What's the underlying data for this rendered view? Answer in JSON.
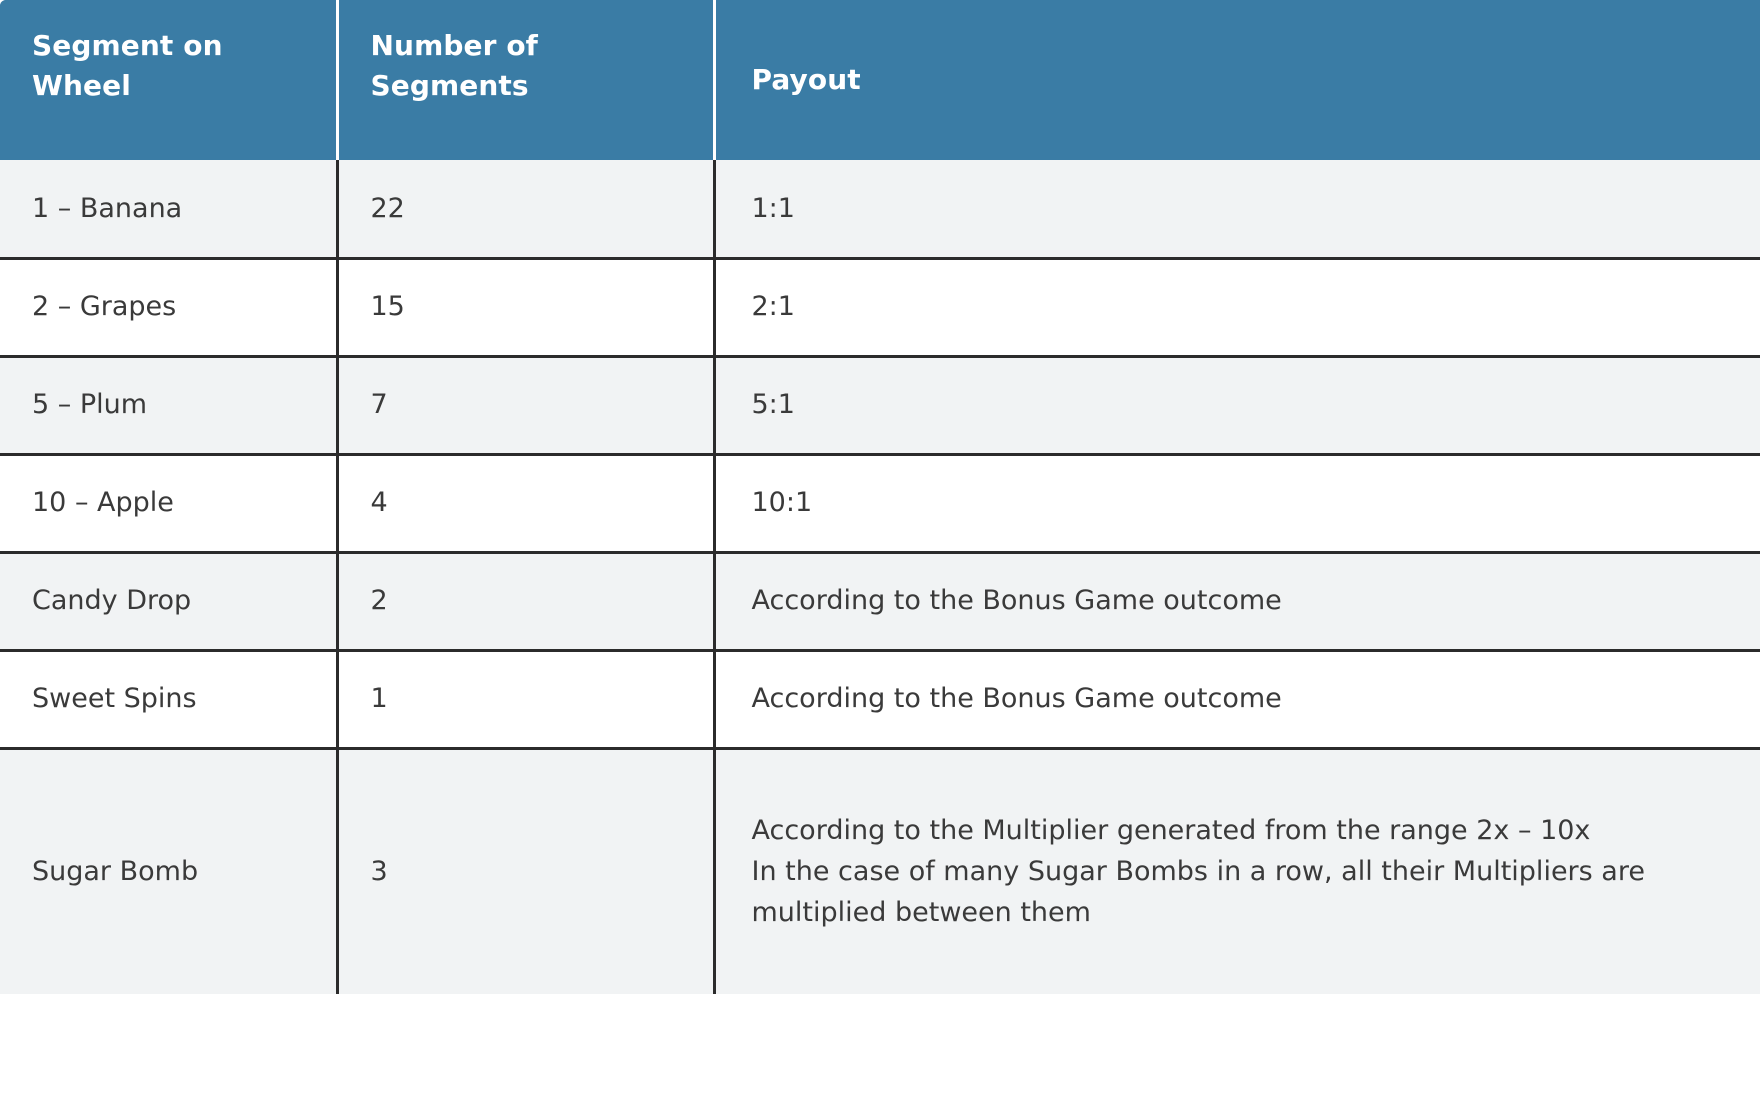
{
  "table": {
    "columns": [
      {
        "key": "segment",
        "label": "Segment on Wheel"
      },
      {
        "key": "count",
        "label": "Number of Segments"
      },
      {
        "key": "payout",
        "label": "Payout"
      }
    ],
    "header_background": "#3a7ca5",
    "header_text_color": "#ffffff",
    "stripe_background": "#f1f3f4",
    "row_background": "#ffffff",
    "border_color": "#2b2b2b",
    "body_text_color": "#3a3a3a",
    "rows": [
      {
        "segment": "1 – Banana",
        "count": "22",
        "payout_lines": [
          "1:1"
        ]
      },
      {
        "segment": "2 – Grapes",
        "count": "15",
        "payout_lines": [
          "2:1"
        ]
      },
      {
        "segment": "5 – Plum",
        "count": "7",
        "payout_lines": [
          "5:1"
        ]
      },
      {
        "segment": "10 – Apple",
        "count": "4",
        "payout_lines": [
          "10:1"
        ]
      },
      {
        "segment": "Candy Drop",
        "count": "2",
        "payout_lines": [
          "According to the Bonus Game outcome"
        ]
      },
      {
        "segment": "Sweet Spins",
        "count": "1",
        "payout_lines": [
          "According to the Bonus Game outcome"
        ]
      },
      {
        "segment": "Sugar Bomb",
        "count": "3",
        "payout_lines": [
          "According to the Multiplier generated from the range 2x – 10x",
          "In the case of many Sugar Bombs in a row, all their Multipliers are multiplied between them"
        ]
      }
    ]
  }
}
